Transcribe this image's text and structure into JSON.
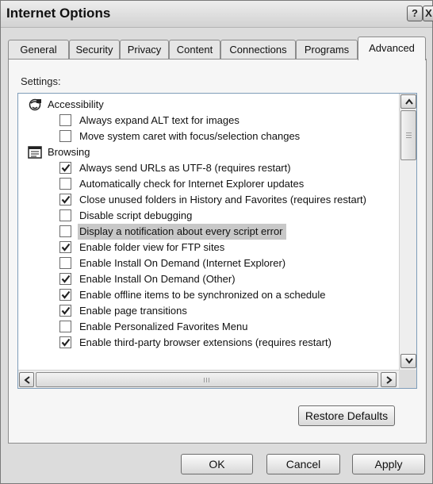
{
  "window": {
    "title": "Internet Options",
    "help_glyph": "?",
    "close_glyph": "X"
  },
  "tabs": [
    {
      "label": "General"
    },
    {
      "label": "Security"
    },
    {
      "label": "Privacy"
    },
    {
      "label": "Content"
    },
    {
      "label": "Connections"
    },
    {
      "label": "Programs"
    },
    {
      "label": "Advanced",
      "active": true
    }
  ],
  "advanced": {
    "settings_label": "Settings:",
    "items": [
      {
        "type": "category",
        "icon": "accessibility-icon",
        "label": "Accessibility"
      },
      {
        "type": "checkbox",
        "checked": false,
        "label": "Always expand ALT text for images"
      },
      {
        "type": "checkbox",
        "checked": false,
        "label": "Move system caret with focus/selection changes"
      },
      {
        "type": "category",
        "icon": "browsing-icon",
        "label": "Browsing"
      },
      {
        "type": "checkbox",
        "checked": true,
        "label": "Always send URLs as UTF-8 (requires restart)"
      },
      {
        "type": "checkbox",
        "checked": false,
        "label": "Automatically check for Internet Explorer updates"
      },
      {
        "type": "checkbox",
        "checked": true,
        "label": "Close unused folders in History and Favorites (requires restart)"
      },
      {
        "type": "checkbox",
        "checked": false,
        "label": "Disable script debugging"
      },
      {
        "type": "checkbox",
        "checked": false,
        "label": "Display a notification about every script error",
        "selected": true
      },
      {
        "type": "checkbox",
        "checked": true,
        "label": "Enable folder view for FTP sites"
      },
      {
        "type": "checkbox",
        "checked": false,
        "label": "Enable Install On Demand (Internet Explorer)"
      },
      {
        "type": "checkbox",
        "checked": true,
        "label": "Enable Install On Demand (Other)"
      },
      {
        "type": "checkbox",
        "checked": true,
        "label": "Enable offline items to be synchronized on a schedule"
      },
      {
        "type": "checkbox",
        "checked": true,
        "label": "Enable page transitions"
      },
      {
        "type": "checkbox",
        "checked": false,
        "label": "Enable Personalized Favorites Menu"
      },
      {
        "type": "checkbox",
        "checked": true,
        "label": "Enable third-party browser extensions (requires restart)"
      }
    ],
    "restore_defaults_label": "Restore Defaults"
  },
  "footer": {
    "ok_label": "OK",
    "cancel_label": "Cancel",
    "apply_label": "Apply"
  },
  "colors": {
    "dialog_face": "#dcdcdc",
    "panel_face": "#f6f6f6",
    "selection": "#c8c8c8"
  }
}
